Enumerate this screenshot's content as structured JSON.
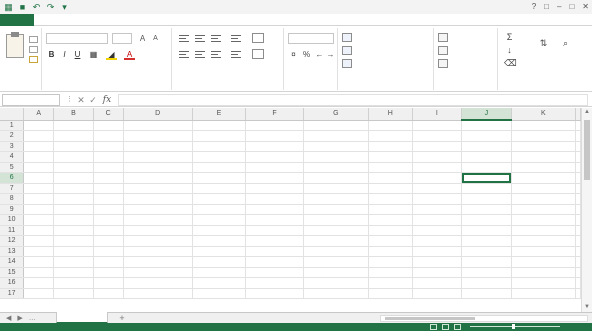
{
  "window": {
    "title": "",
    "controls": {
      "help": "?",
      "restore": "□",
      "minimize": "–",
      "maximize": "□",
      "close": "✕"
    }
  },
  "ribbon_tabs": {
    "file": "",
    "tabs": [
      "",
      "",
      "",
      "",
      "",
      "",
      "",
      "",
      ""
    ],
    "account": ""
  },
  "ribbon_groups": {
    "clipboard": "",
    "font": "",
    "alignment": "",
    "number": "",
    "styles": "",
    "cells": "",
    "editing": ""
  },
  "ribbon": {
    "font_name": "",
    "font_size": "",
    "number_format": "",
    "styles": [
      "",
      "",
      ""
    ],
    "cells": [
      "",
      "",
      ""
    ],
    "editing_icons": {
      "sum": "Σ",
      "fill": "↓",
      "clear": "⌫",
      "sort": "⇅",
      "find": "⌕"
    },
    "fill_color": "#f2d100",
    "font_color": "#c00000"
  },
  "formula_bar": {
    "name_box": "",
    "formula": ""
  },
  "grid": {
    "columns": [
      "A",
      "B",
      "C",
      "D",
      "E",
      "F",
      "G",
      "H",
      "I",
      "J",
      "K"
    ],
    "selected_column": "J",
    "selected_row": 6,
    "rows": [
      [
        "",
        "",
        "",
        "",
        "",
        "",
        "",
        "",
        "",
        "",
        ""
      ],
      [
        "",
        "",
        "",
        "",
        "",
        "",
        "",
        "",
        "",
        "",
        ""
      ],
      [
        "",
        "",
        "",
        "",
        "",
        "",
        "",
        "",
        "",
        "",
        ""
      ],
      [
        "",
        "",
        "",
        "",
        "",
        "",
        "",
        "",
        "",
        "",
        ""
      ],
      [
        "",
        "",
        "",
        "",
        "",
        "",
        "",
        "",
        "",
        "",
        ""
      ],
      [
        "",
        "",
        "",
        "",
        "",
        "",
        "",
        "",
        "",
        "",
        ""
      ],
      [
        "",
        "",
        "",
        "",
        "",
        "",
        "",
        "",
        "",
        "",
        ""
      ],
      [
        "",
        "",
        "",
        "",
        "",
        "",
        "",
        "",
        "",
        "",
        ""
      ],
      [
        "",
        "",
        "",
        "",
        "",
        "",
        "",
        "",
        "",
        "",
        ""
      ],
      [
        "",
        "",
        "",
        "",
        "",
        "",
        "",
        "",
        "",
        "",
        ""
      ],
      [
        "",
        "",
        "",
        "",
        "",
        "",
        "",
        "",
        "",
        "",
        ""
      ],
      [
        "",
        "",
        "",
        "",
        "",
        "",
        "",
        "",
        "",
        "",
        ""
      ],
      [
        "",
        "",
        "",
        "",
        "",
        "",
        "",
        "",
        "",
        "",
        ""
      ],
      [
        "",
        "",
        "",
        "",
        "",
        "",
        "",
        "",
        "",
        "",
        ""
      ],
      [
        "",
        "",
        "",
        "",
        "",
        "",
        "",
        "",
        "",
        "",
        ""
      ],
      [
        "",
        "",
        "",
        "",
        "",
        "",
        "",
        "",
        "",
        "",
        ""
      ],
      [
        "",
        "",
        "",
        "",
        "",
        "",
        "",
        "",
        "",
        "",
        ""
      ]
    ]
  },
  "sheets": {
    "active": "",
    "add": "+"
  },
  "status": {
    "ready": "",
    "zoom": ""
  },
  "colors": {
    "accent": "#217346",
    "selected_header": "#d3e3d6",
    "gridline": "#e2e2e2"
  }
}
